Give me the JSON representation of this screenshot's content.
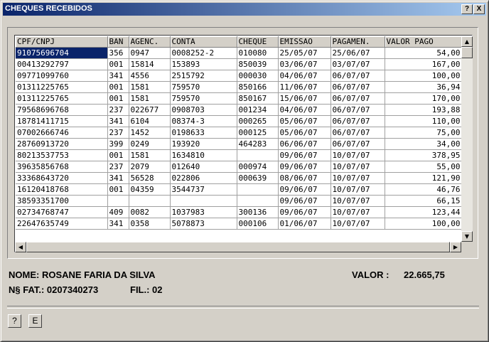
{
  "window": {
    "title": "CHEQUES RECEBIDOS",
    "help_btn": "?",
    "close_btn": "X"
  },
  "grid": {
    "columns": [
      "CPF/CNPJ",
      "BAN",
      "AGENC.",
      "CONTA",
      "CHEQUE",
      "EMISSAO",
      "PAGAMEN.",
      "VALOR PAGO"
    ],
    "selected_row": 0,
    "rows": [
      [
        "91075696704",
        "356",
        "0947",
        "0008252-2",
        "010080",
        "25/05/07",
        "25/06/07",
        "54,00"
      ],
      [
        "00413292797",
        "001",
        "15814",
        "153893",
        "850039",
        "03/06/07",
        "03/07/07",
        "167,00"
      ],
      [
        "09771099760",
        "341",
        "4556",
        "2515792",
        "000030",
        "04/06/07",
        "06/07/07",
        "100,00"
      ],
      [
        "01311225765",
        "001",
        "1581",
        "759570",
        "850166",
        "11/06/07",
        "06/07/07",
        "36,94"
      ],
      [
        "01311225765",
        "001",
        "1581",
        "759570",
        "850167",
        "15/06/07",
        "06/07/07",
        "170,00"
      ],
      [
        "79568696768",
        "237",
        "022677",
        "0908703",
        "001234",
        "04/06/07",
        "06/07/07",
        "193,88"
      ],
      [
        "18781411715",
        "341",
        "6104",
        "08374-3",
        "000265",
        "05/06/07",
        "06/07/07",
        "110,00"
      ],
      [
        "07002666746",
        "237",
        "1452",
        "0198633",
        "000125",
        "05/06/07",
        "06/07/07",
        "75,00"
      ],
      [
        "28760913720",
        "399",
        "0249",
        "193920",
        "464283",
        "06/06/07",
        "06/07/07",
        "34,00"
      ],
      [
        "80213537753",
        "001",
        "1581",
        "1634810",
        "",
        "09/06/07",
        "10/07/07",
        "378,95"
      ],
      [
        "39635856768",
        "237",
        "2079",
        "012640",
        "000974",
        "09/06/07",
        "10/07/07",
        "55,00"
      ],
      [
        "33368643720",
        "341",
        "56528",
        "022806",
        "000639",
        "08/06/07",
        "10/07/07",
        "121,90"
      ],
      [
        "16120418768",
        "001",
        "04359",
        "3544737",
        "",
        "09/06/07",
        "10/07/07",
        "46,76"
      ],
      [
        "38593351700",
        "",
        "",
        "",
        "",
        "09/06/07",
        "10/07/07",
        "66,15"
      ],
      [
        "02734768747",
        "409",
        "0082",
        "1037983",
        "300136",
        "09/06/07",
        "10/07/07",
        "123,44"
      ],
      [
        "22647635749",
        "341",
        "0358",
        "5078873",
        "000106",
        "01/06/07",
        "10/07/07",
        "100,00"
      ]
    ]
  },
  "scrollbars": {
    "up": "▲",
    "down": "▼",
    "left": "◀",
    "right": "▶"
  },
  "footer": {
    "nome_label": "NOME: ROSANE FARIA DA SILVA",
    "valor_label": "VALOR :",
    "valor_value": "22.665,75",
    "fatura_label": "N§ FAT.: 0207340273",
    "filial_label": "FIL.: 02",
    "help_button": "?",
    "e_button": "E"
  }
}
